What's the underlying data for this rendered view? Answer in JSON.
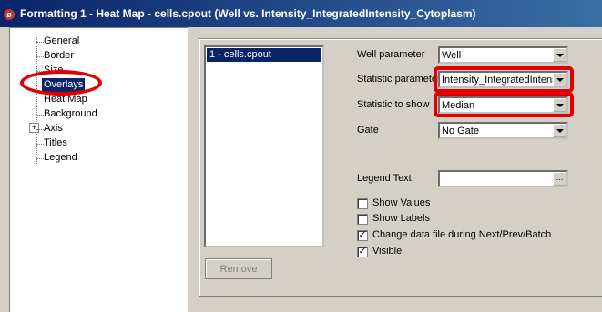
{
  "window": {
    "title": "Formatting 1 - Heat Map - cells.cpout (Well vs. Intensity_IntegratedIntensity_Cytoplasm)",
    "icon": "app-icon"
  },
  "tree": {
    "items": [
      {
        "label": "General"
      },
      {
        "label": "Border"
      },
      {
        "label": "Size"
      },
      {
        "label": "Overlays",
        "selected": true
      },
      {
        "label": "Heat Map",
        "expandable": true
      },
      {
        "label": "Background"
      },
      {
        "label": "Axis"
      },
      {
        "label": "Titles"
      },
      {
        "label": "Legend"
      }
    ],
    "expander_glyph": "+"
  },
  "list": {
    "items": [
      "1 - cells.cpout"
    ],
    "remove_label": "Remove"
  },
  "form": {
    "well_parameter": {
      "label": "Well parameter",
      "value": "Well"
    },
    "statistic_parameter": {
      "label": "Statistic parameter",
      "value": "Intensity_IntegratedIntensity_Cytoplasm"
    },
    "statistic_to_show": {
      "label": "Statistic to show",
      "value": "Median"
    },
    "gate": {
      "label": "Gate",
      "value": "No Gate"
    },
    "legend_text": {
      "label": "Legend Text",
      "value": "",
      "button": "..."
    }
  },
  "checkboxes": [
    {
      "label": "Show Values",
      "checked": false
    },
    {
      "label": "Show Labels",
      "checked": false
    },
    {
      "label": "Change data file during Next/Prev/Batch",
      "checked": true
    },
    {
      "label": "Visible",
      "checked": true
    }
  ],
  "colors": {
    "highlight": "#e00000",
    "selection": "#0a246a"
  }
}
